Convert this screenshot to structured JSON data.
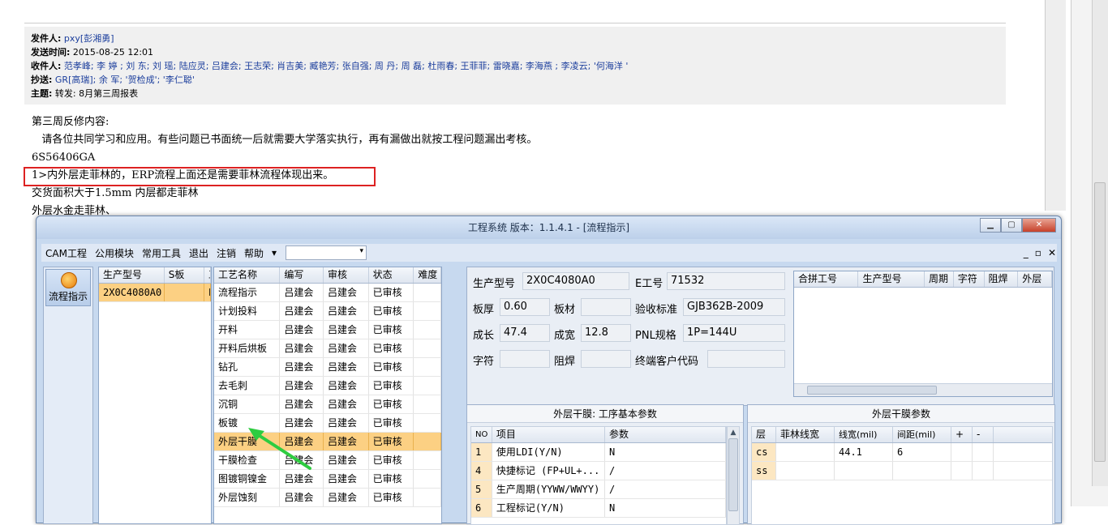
{
  "email": {
    "header": {
      "sender_label": "发件人:",
      "sender": "pxy[彭湘勇]",
      "time_label": "发送时间:",
      "time": "2015-08-25 12:01",
      "recipients_label": "收件人:",
      "recipients": "范孝峰; 李 婷 ; 刘 东; 刘 瑶; 陆应灵; 吕建会; 王志荣; 肖吉美; 臧艳芳; 张自强; 周 丹; 周 磊; 杜雨春; 王菲菲; 雷晓嘉; 李海燕 ; 李凌云; '何海洋 '",
      "cc_label": "抄送:",
      "cc": "GR[高瑞]; 余 军; '贺检成'; '李仁聪'",
      "subject_label": "主题:",
      "subject": "转发: 8月第三周报表"
    },
    "body_lines": [
      "第三周反修内容:",
      "   请各位共同学习和应用。有些问题已书面统一后就需要大学落实执行，再有漏做出就按工程问题漏出考核。",
      "6S56406GA",
      "1>内外层走菲林的，ERP流程上面还是需要菲林流程体现出来。",
      "交货面积大于1.5mm 内层都走菲林",
      "外层水金走菲林、"
    ]
  },
  "app": {
    "title": "工程系统   版本：1.1.4.1 - [流程指示]",
    "menu": [
      "CAM工程",
      "公用模块",
      "常用工具",
      "退出",
      "注销",
      "帮助"
    ],
    "menu_more": "▾",
    "mdi_controls": [
      "_",
      "▫",
      "✕"
    ],
    "nav_button": "流程指示",
    "model_grid": {
      "headers": [
        "生产型号",
        "S板",
        "工"
      ],
      "rows": [
        [
          "2X0C4080A0",
          "",
          "P:"
        ]
      ]
    },
    "process_grid": {
      "headers": [
        "工艺名称",
        "编写",
        "审核",
        "状态",
        "难度"
      ],
      "rows": [
        [
          "流程指示",
          "吕建会",
          "吕建会",
          "已审核",
          ""
        ],
        [
          "计划投料",
          "吕建会",
          "吕建会",
          "已审核",
          ""
        ],
        [
          "开料",
          "吕建会",
          "吕建会",
          "已审核",
          ""
        ],
        [
          "开料后烘板",
          "吕建会",
          "吕建会",
          "已审核",
          ""
        ],
        [
          "钻孔",
          "吕建会",
          "吕建会",
          "已审核",
          ""
        ],
        [
          "去毛刺",
          "吕建会",
          "吕建会",
          "已审核",
          ""
        ],
        [
          "沉铜",
          "吕建会",
          "吕建会",
          "已审核",
          ""
        ],
        [
          "板镀",
          "吕建会",
          "吕建会",
          "已审核",
          ""
        ],
        [
          "外层干膜",
          "吕建会",
          "吕建会",
          "已审核",
          ""
        ],
        [
          "干膜检查",
          "吕建会",
          "吕建会",
          "已审核",
          ""
        ],
        [
          "图镀铜镍金",
          "吕建会",
          "吕建会",
          "已审核",
          ""
        ],
        [
          "外层蚀刻",
          "吕建会",
          "吕建会",
          "已审核",
          ""
        ]
      ],
      "selected_row": "外层干膜"
    },
    "info": {
      "model_label": "生产型号",
      "model": "2X0C4080A0",
      "e_label": "E工号",
      "e": "71532",
      "thickness_label": "板厚",
      "thickness": "0.60",
      "material_label": "板材",
      "material": "",
      "standard_label": "验收标准",
      "standard": "GJB362B-2009",
      "length_label": "成长",
      "length": "47.4",
      "width_label": "成宽",
      "width": "12.8",
      "pnl_label": "PNL规格",
      "pnl": "1P=144U",
      "char_label": "字符",
      "char": "",
      "mask_label": "阻焊",
      "mask": "",
      "customer_label": "终端客户代码",
      "customer": ""
    },
    "combine_grid": {
      "headers": [
        "合拼工号",
        "生产型号",
        "周期",
        "字符",
        "阻焊",
        "外层"
      ]
    },
    "params_panel": {
      "title": "外层干膜: 工序基本参数",
      "headers": [
        "NO",
        "项目",
        "参数"
      ],
      "rows": [
        [
          "1",
          "使用LDI(Y/N)",
          "N"
        ],
        [
          "4",
          "快捷标记 (FP+UL+...",
          "/"
        ],
        [
          "5",
          "生产周期(YYWW/WWYY)",
          "/"
        ],
        [
          "6",
          "工程标记(Y/N)",
          "N"
        ]
      ]
    },
    "film_panel": {
      "title": "外层干膜参数",
      "headers": [
        "层",
        "菲林线宽",
        "线宽(mil)",
        "间距(mil)",
        "+",
        "-"
      ],
      "rows": [
        [
          "cs",
          "",
          "44.1",
          "6",
          "",
          ""
        ],
        [
          "ss",
          "",
          "",
          "",
          "",
          ""
        ]
      ]
    }
  }
}
